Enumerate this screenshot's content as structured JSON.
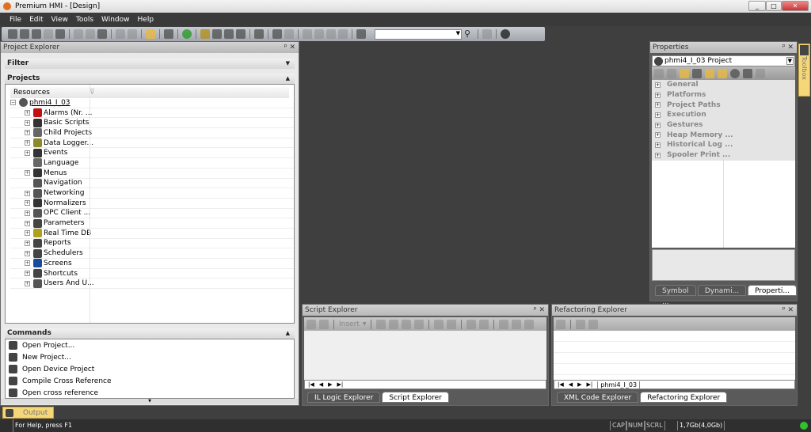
{
  "window": {
    "title": "Premium HMI - [Design]",
    "controls": [
      "_",
      "□",
      "✕"
    ]
  },
  "menu": [
    "File",
    "Edit",
    "View",
    "Tools",
    "Window",
    "Help"
  ],
  "project_explorer": {
    "title": "Project Explorer",
    "filter_label": "Filter",
    "projects_label": "Projects",
    "column_header": "Resources",
    "root": "phmi4_I_03",
    "items": [
      {
        "label": "Alarms (Nr. ...",
        "icon": "alarm-bell-icon",
        "color": "#c01010",
        "expandable": true
      },
      {
        "label": "Basic Scripts",
        "icon": "script-icon",
        "color": "#333333",
        "expandable": true
      },
      {
        "label": "Child Projects",
        "icon": "gears-icon",
        "color": "#666666",
        "expandable": true
      },
      {
        "label": "Data Logger...",
        "icon": "database-icon",
        "color": "#8a8a2a",
        "expandable": true
      },
      {
        "label": "Events",
        "icon": "events-icon",
        "color": "#333333",
        "expandable": true
      },
      {
        "label": "Language",
        "icon": "language-icon",
        "color": "#666666",
        "expandable": false
      },
      {
        "label": "Menus",
        "icon": "menu-icon",
        "color": "#333333",
        "expandable": true
      },
      {
        "label": "Navigation",
        "icon": "navigation-icon",
        "color": "#555555",
        "expandable": false
      },
      {
        "label": "Networking",
        "icon": "network-icon",
        "color": "#555555",
        "expandable": true
      },
      {
        "label": "Normalizers",
        "icon": "normalizer-icon",
        "color": "#333333",
        "expandable": true
      },
      {
        "label": "OPC Client ...",
        "icon": "opc-icon",
        "color": "#555555",
        "expandable": true
      },
      {
        "label": "Parameters",
        "icon": "parameters-icon",
        "color": "#444444",
        "expandable": true
      },
      {
        "label": "Real Time DB",
        "icon": "realtime-db-icon",
        "color": "#b0a020",
        "expandable": true
      },
      {
        "label": "Reports",
        "icon": "report-icon",
        "color": "#444444",
        "expandable": true
      },
      {
        "label": "Schedulers",
        "icon": "clock-icon",
        "color": "#444444",
        "expandable": true
      },
      {
        "label": "Screens",
        "icon": "screen-icon",
        "color": "#1a4a9a",
        "expandable": true
      },
      {
        "label": "Shortcuts",
        "icon": "shortcut-icon",
        "color": "#444444",
        "expandable": true
      },
      {
        "label": "Users And U...",
        "icon": "users-icon",
        "color": "#555555",
        "expandable": true
      }
    ],
    "commands_label": "Commands",
    "commands": [
      "Open Project...",
      "New Project...",
      "Open Device Project",
      "Compile Cross Reference",
      "Open cross reference"
    ]
  },
  "output_tab": "Output",
  "properties": {
    "title": "Properties",
    "selector": "phmi4_I_03 Project",
    "groups": [
      "General",
      "Platforms",
      "Project Paths",
      "Execution",
      "Gestures",
      "Heap Memory ...",
      "Historical Log ...",
      "Spooler Print ..."
    ],
    "tabs": [
      "Symbol ...",
      "Dynami...",
      "Properti..."
    ]
  },
  "toolbox_label": "Toolbox",
  "script_explorer": {
    "title": "Script Explorer",
    "insert_label": "Insert",
    "tabs": [
      "IL Logic Explorer",
      "Script Explorer"
    ]
  },
  "refactoring_explorer": {
    "title": "Refactoring Explorer",
    "sheet_tab": "phmi4_I_03",
    "tabs": [
      "XML Code Explorer",
      "Refactoring Explorer"
    ]
  },
  "status": {
    "help": "For Help, press F1",
    "cap": "CAP",
    "num": "NUM",
    "scrl": "SCRL",
    "memory": "1,7Gb(4,0Gb)"
  },
  "colors": {
    "accent": "#f5d77a",
    "status_ok": "#30c030"
  }
}
